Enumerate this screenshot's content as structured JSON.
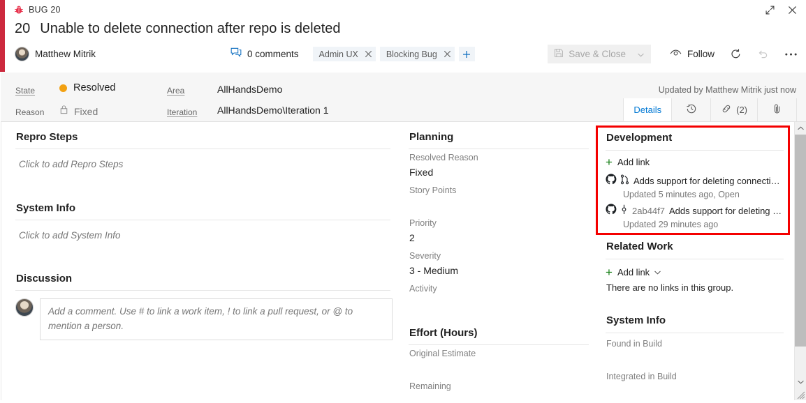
{
  "header": {
    "work_item_type": "BUG 20",
    "id": "20",
    "title": "Unable to delete connection after repo is deleted",
    "assigned_to": "Matthew Mitrik",
    "comments": "0 comments",
    "tags": [
      {
        "label": "Admin UX",
        "remove": "✕"
      },
      {
        "label": "Blocking Bug",
        "remove": "✕"
      }
    ],
    "add_tag": "+",
    "save_close_label": "Save & Close",
    "follow_label": "Follow",
    "icons": {
      "bug": "bug-icon",
      "expand": "expand-icon",
      "close": "close-icon",
      "comments": "comment-bubble-icon",
      "save": "save-icon",
      "dropdown": "chevron-down-icon",
      "eye": "eye-icon",
      "refresh": "refresh-icon",
      "undo": "undo-icon",
      "more": "•••"
    }
  },
  "fields": {
    "state_label": "State",
    "state_value": "Resolved",
    "state_color": "#f2a112",
    "reason_label": "Reason",
    "reason_value": "Fixed",
    "area_label": "Area",
    "area_value": "AllHandsDemo",
    "iteration_label": "Iteration",
    "iteration_value": "AllHandsDemo\\Iteration 1",
    "updated_by": "Updated by Matthew Mitrik just now",
    "tabs": [
      {
        "label": "Details",
        "active": true
      },
      {
        "label": "history-icon",
        "active": false
      },
      {
        "label": "(2)",
        "active": false
      },
      {
        "label": "attachment-icon",
        "active": false
      }
    ],
    "links_count": "(2)"
  },
  "left": {
    "repro_steps_title": "Repro Steps",
    "repro_steps_placeholder": "Click to add Repro Steps",
    "system_info_title": "System Info",
    "system_info_placeholder": "Click to add System Info",
    "discussion_title": "Discussion",
    "comment_placeholder": "Add a comment. Use # to link a work item, ! to link a pull request, or @ to mention a person."
  },
  "planning": {
    "title": "Planning",
    "fields": [
      {
        "label": "Resolved Reason",
        "value": "Fixed"
      },
      {
        "label": "Story Points",
        "value": ""
      },
      {
        "label": "Priority",
        "value": "2"
      },
      {
        "label": "Severity",
        "value": "3 - Medium"
      },
      {
        "label": "Activity",
        "value": ""
      }
    ],
    "effort_title": "Effort (Hours)",
    "effort_fields": [
      {
        "label": "Original Estimate",
        "value": ""
      },
      {
        "label": "Remaining",
        "value": ""
      }
    ]
  },
  "development": {
    "title": "Development",
    "add_link": "Add link",
    "items": [
      {
        "kind": "pull-request",
        "sha": "",
        "title": "Adds support for deleting connecti…",
        "subtitle": "Updated 5 minutes ago,  Open"
      },
      {
        "kind": "commit",
        "sha": "2ab44f7",
        "title": "Adds support for deleting …",
        "subtitle": "Updated 29 minutes ago"
      }
    ]
  },
  "related_work": {
    "title": "Related Work",
    "add_link": "Add link",
    "empty_text": "There are no links in this group."
  },
  "right_system_info": {
    "title": "System Info",
    "fields": [
      {
        "label": "Found in Build",
        "value": ""
      },
      {
        "label": "Integrated in Build",
        "value": ""
      }
    ]
  },
  "colors": {
    "accent_red": "#cc293d",
    "highlight_red": "#f40000",
    "link_blue": "#0078d4",
    "add_green": "#107c10",
    "state_orange": "#f2a112"
  }
}
